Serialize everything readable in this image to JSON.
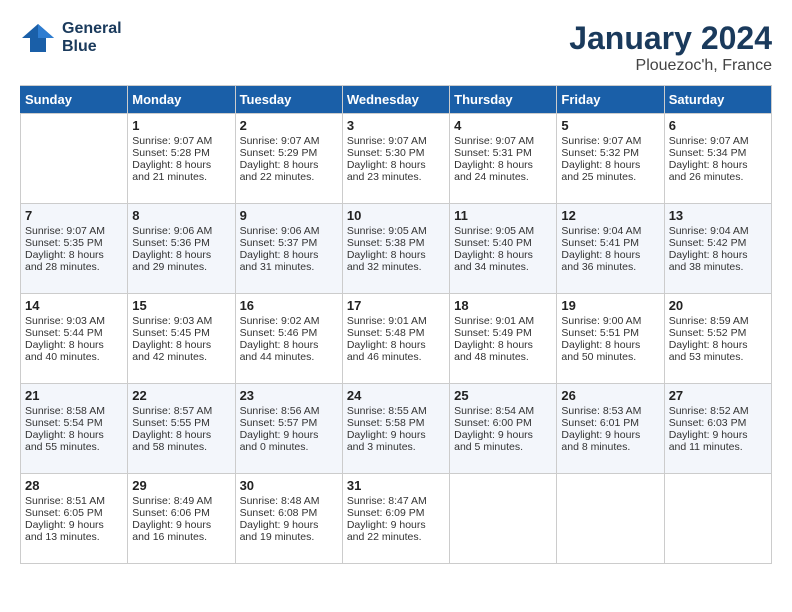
{
  "logo": {
    "line1": "General",
    "line2": "Blue"
  },
  "title": "January 2024",
  "location": "Plouezoc'h, France",
  "weekdays": [
    "Sunday",
    "Monday",
    "Tuesday",
    "Wednesday",
    "Thursday",
    "Friday",
    "Saturday"
  ],
  "weeks": [
    [
      {
        "day": "",
        "sunrise": "",
        "sunset": "",
        "daylight": ""
      },
      {
        "day": "1",
        "sunrise": "Sunrise: 9:07 AM",
        "sunset": "Sunset: 5:28 PM",
        "daylight": "Daylight: 8 hours and 21 minutes."
      },
      {
        "day": "2",
        "sunrise": "Sunrise: 9:07 AM",
        "sunset": "Sunset: 5:29 PM",
        "daylight": "Daylight: 8 hours and 22 minutes."
      },
      {
        "day": "3",
        "sunrise": "Sunrise: 9:07 AM",
        "sunset": "Sunset: 5:30 PM",
        "daylight": "Daylight: 8 hours and 23 minutes."
      },
      {
        "day": "4",
        "sunrise": "Sunrise: 9:07 AM",
        "sunset": "Sunset: 5:31 PM",
        "daylight": "Daylight: 8 hours and 24 minutes."
      },
      {
        "day": "5",
        "sunrise": "Sunrise: 9:07 AM",
        "sunset": "Sunset: 5:32 PM",
        "daylight": "Daylight: 8 hours and 25 minutes."
      },
      {
        "day": "6",
        "sunrise": "Sunrise: 9:07 AM",
        "sunset": "Sunset: 5:34 PM",
        "daylight": "Daylight: 8 hours and 26 minutes."
      }
    ],
    [
      {
        "day": "7",
        "sunrise": "Sunrise: 9:07 AM",
        "sunset": "Sunset: 5:35 PM",
        "daylight": "Daylight: 8 hours and 28 minutes."
      },
      {
        "day": "8",
        "sunrise": "Sunrise: 9:06 AM",
        "sunset": "Sunset: 5:36 PM",
        "daylight": "Daylight: 8 hours and 29 minutes."
      },
      {
        "day": "9",
        "sunrise": "Sunrise: 9:06 AM",
        "sunset": "Sunset: 5:37 PM",
        "daylight": "Daylight: 8 hours and 31 minutes."
      },
      {
        "day": "10",
        "sunrise": "Sunrise: 9:05 AM",
        "sunset": "Sunset: 5:38 PM",
        "daylight": "Daylight: 8 hours and 32 minutes."
      },
      {
        "day": "11",
        "sunrise": "Sunrise: 9:05 AM",
        "sunset": "Sunset: 5:40 PM",
        "daylight": "Daylight: 8 hours and 34 minutes."
      },
      {
        "day": "12",
        "sunrise": "Sunrise: 9:04 AM",
        "sunset": "Sunset: 5:41 PM",
        "daylight": "Daylight: 8 hours and 36 minutes."
      },
      {
        "day": "13",
        "sunrise": "Sunrise: 9:04 AM",
        "sunset": "Sunset: 5:42 PM",
        "daylight": "Daylight: 8 hours and 38 minutes."
      }
    ],
    [
      {
        "day": "14",
        "sunrise": "Sunrise: 9:03 AM",
        "sunset": "Sunset: 5:44 PM",
        "daylight": "Daylight: 8 hours and 40 minutes."
      },
      {
        "day": "15",
        "sunrise": "Sunrise: 9:03 AM",
        "sunset": "Sunset: 5:45 PM",
        "daylight": "Daylight: 8 hours and 42 minutes."
      },
      {
        "day": "16",
        "sunrise": "Sunrise: 9:02 AM",
        "sunset": "Sunset: 5:46 PM",
        "daylight": "Daylight: 8 hours and 44 minutes."
      },
      {
        "day": "17",
        "sunrise": "Sunrise: 9:01 AM",
        "sunset": "Sunset: 5:48 PM",
        "daylight": "Daylight: 8 hours and 46 minutes."
      },
      {
        "day": "18",
        "sunrise": "Sunrise: 9:01 AM",
        "sunset": "Sunset: 5:49 PM",
        "daylight": "Daylight: 8 hours and 48 minutes."
      },
      {
        "day": "19",
        "sunrise": "Sunrise: 9:00 AM",
        "sunset": "Sunset: 5:51 PM",
        "daylight": "Daylight: 8 hours and 50 minutes."
      },
      {
        "day": "20",
        "sunrise": "Sunrise: 8:59 AM",
        "sunset": "Sunset: 5:52 PM",
        "daylight": "Daylight: 8 hours and 53 minutes."
      }
    ],
    [
      {
        "day": "21",
        "sunrise": "Sunrise: 8:58 AM",
        "sunset": "Sunset: 5:54 PM",
        "daylight": "Daylight: 8 hours and 55 minutes."
      },
      {
        "day": "22",
        "sunrise": "Sunrise: 8:57 AM",
        "sunset": "Sunset: 5:55 PM",
        "daylight": "Daylight: 8 hours and 58 minutes."
      },
      {
        "day": "23",
        "sunrise": "Sunrise: 8:56 AM",
        "sunset": "Sunset: 5:57 PM",
        "daylight": "Daylight: 9 hours and 0 minutes."
      },
      {
        "day": "24",
        "sunrise": "Sunrise: 8:55 AM",
        "sunset": "Sunset: 5:58 PM",
        "daylight": "Daylight: 9 hours and 3 minutes."
      },
      {
        "day": "25",
        "sunrise": "Sunrise: 8:54 AM",
        "sunset": "Sunset: 6:00 PM",
        "daylight": "Daylight: 9 hours and 5 minutes."
      },
      {
        "day": "26",
        "sunrise": "Sunrise: 8:53 AM",
        "sunset": "Sunset: 6:01 PM",
        "daylight": "Daylight: 9 hours and 8 minutes."
      },
      {
        "day": "27",
        "sunrise": "Sunrise: 8:52 AM",
        "sunset": "Sunset: 6:03 PM",
        "daylight": "Daylight: 9 hours and 11 minutes."
      }
    ],
    [
      {
        "day": "28",
        "sunrise": "Sunrise: 8:51 AM",
        "sunset": "Sunset: 6:05 PM",
        "daylight": "Daylight: 9 hours and 13 minutes."
      },
      {
        "day": "29",
        "sunrise": "Sunrise: 8:49 AM",
        "sunset": "Sunset: 6:06 PM",
        "daylight": "Daylight: 9 hours and 16 minutes."
      },
      {
        "day": "30",
        "sunrise": "Sunrise: 8:48 AM",
        "sunset": "Sunset: 6:08 PM",
        "daylight": "Daylight: 9 hours and 19 minutes."
      },
      {
        "day": "31",
        "sunrise": "Sunrise: 8:47 AM",
        "sunset": "Sunset: 6:09 PM",
        "daylight": "Daylight: 9 hours and 22 minutes."
      },
      {
        "day": "",
        "sunrise": "",
        "sunset": "",
        "daylight": ""
      },
      {
        "day": "",
        "sunrise": "",
        "sunset": "",
        "daylight": ""
      },
      {
        "day": "",
        "sunrise": "",
        "sunset": "",
        "daylight": ""
      }
    ]
  ]
}
